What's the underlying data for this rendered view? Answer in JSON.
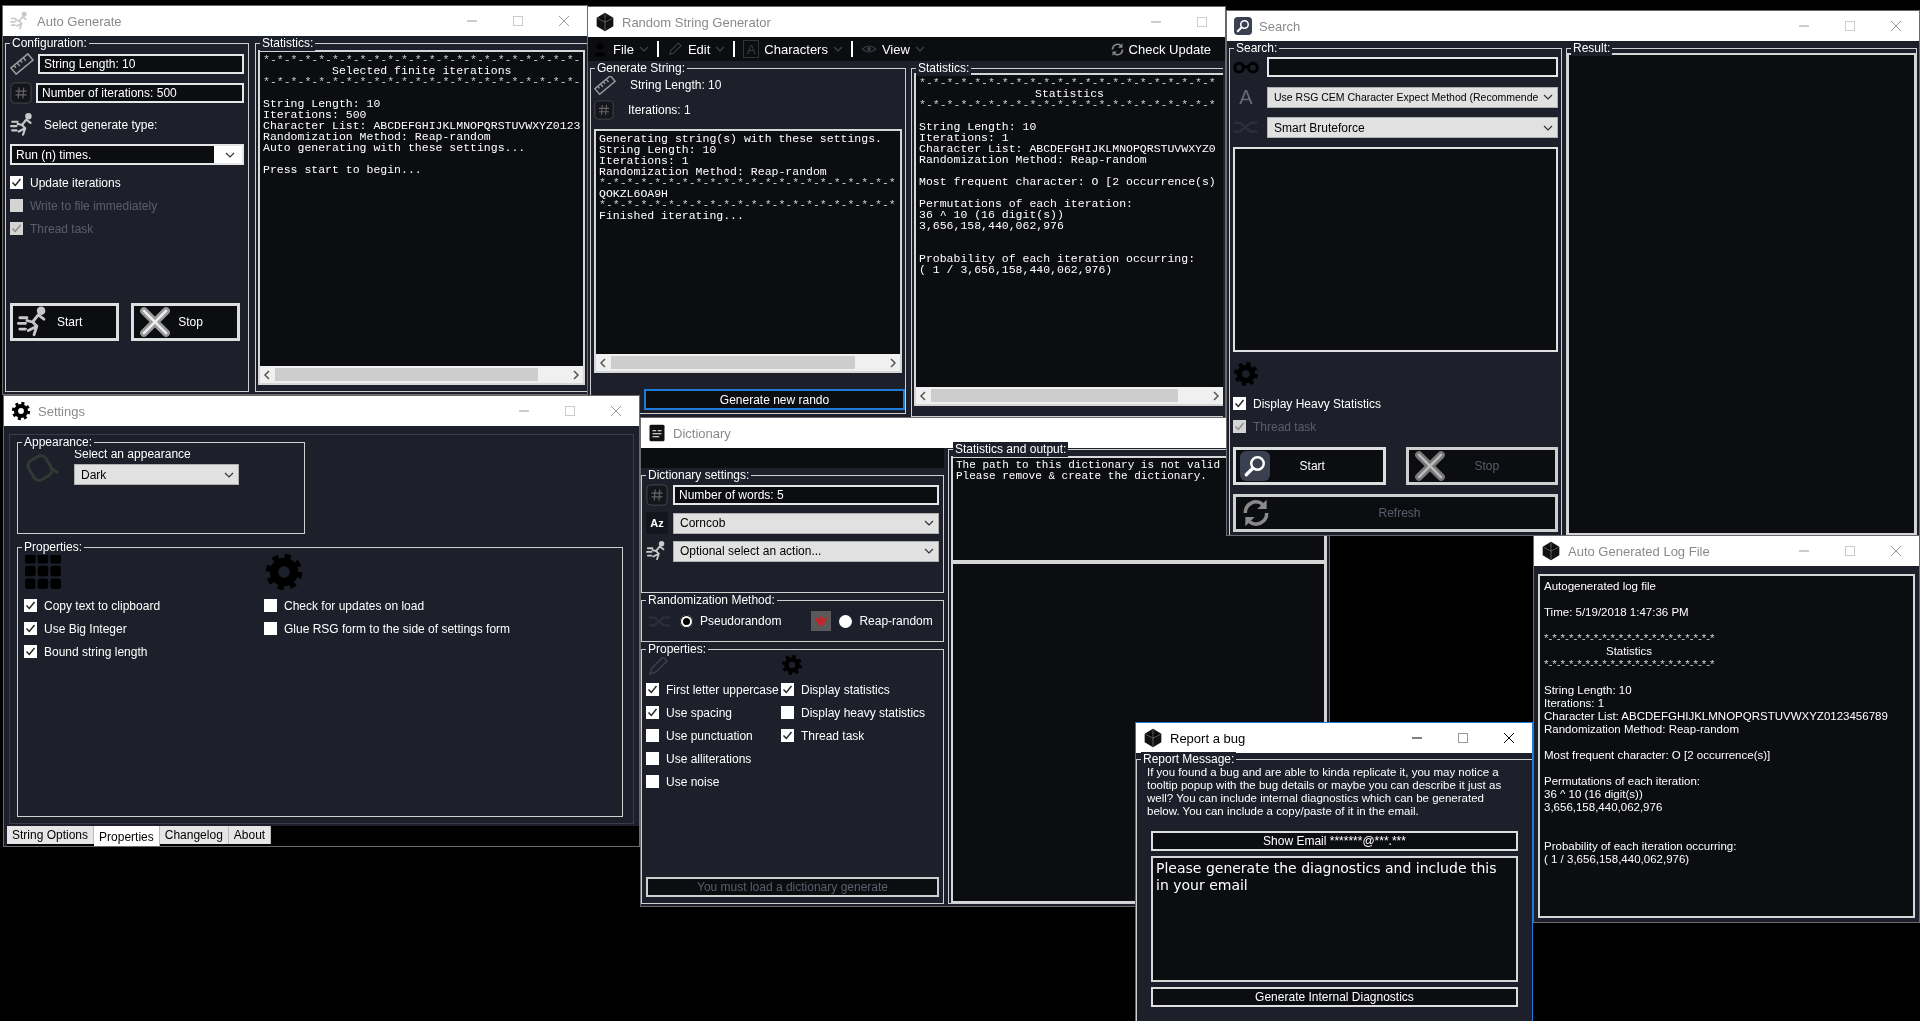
{
  "auto_generate": {
    "title": "Auto Generate",
    "active": false,
    "configuration": {
      "label": "Configuration:",
      "string_length": "String Length: 10",
      "iterations": "Number of iterations: 500",
      "type_label": "Select generate type:",
      "type_value": "Run (n) times.",
      "options": [
        {
          "label": "Update iterations",
          "checked": true,
          "disabled": false
        },
        {
          "label": "Write to file immediately",
          "checked": false,
          "disabled": true
        },
        {
          "label": "Thread task",
          "checked": true,
          "disabled": true
        }
      ],
      "buttons": [
        {
          "kind": "start",
          "label": "Start",
          "disabled": false
        },
        {
          "kind": "stop",
          "label": "Stop",
          "disabled": false
        }
      ]
    },
    "statistics": {
      "label": "Statistics:",
      "lines": [
        {
          "kind": "rule",
          "text": "*-*-*-*-*-*-*-*-*-*-*-*-*-*-*-*-*-*-*-*-*-*-*-"
        },
        {
          "kind": "heading",
          "text": "Selected finite iterations"
        },
        {
          "kind": "rule",
          "text": "*-*-*-*-*-*-*-*-*-*-*-*-*-*-*-*-*-*-*-*-*-*-*-"
        },
        {
          "kind": "gap"
        },
        {
          "kind": "text",
          "text": "String Length: 10"
        },
        {
          "kind": "text",
          "text": "Iterations: 500"
        },
        {
          "kind": "text",
          "text": "Character List: ABCDEFGHIJKLMNOPQRSTUVWXYZ0123"
        },
        {
          "kind": "text",
          "text": "Randomization Method: Reap-random"
        },
        {
          "kind": "text",
          "text": "Auto generating with these settings..."
        },
        {
          "kind": "gap"
        },
        {
          "kind": "text",
          "text": "Press start to begin..."
        }
      ]
    }
  },
  "rsg": {
    "title": "Random String Generator",
    "active": false,
    "menu": [
      {
        "kind": "person",
        "label": "File"
      },
      {
        "kind": "pencil",
        "label": "Edit"
      },
      {
        "kind": "font",
        "icon_text": "A",
        "label": "Characters"
      },
      {
        "kind": "eye",
        "label": "View"
      }
    ],
    "check_update": "Check Update",
    "generate": {
      "label": "Generate String:",
      "string_length": "String Length: 10",
      "iterations": "Iterations: 1",
      "lines": [
        {
          "kind": "text",
          "text": "Generating string(s) with these settings."
        },
        {
          "kind": "text",
          "text": "String Length: 10"
        },
        {
          "kind": "text",
          "text": "Iterations: 1"
        },
        {
          "kind": "text",
          "text": "Randomization Method: Reap-random"
        },
        {
          "kind": "rule",
          "text": "*-*-*-*-*-*-*-*-*-*-*-*-*-*-*-*-*-*-*-*-*-*"
        },
        {
          "kind": "text",
          "text": "QOKZL6OA9H"
        },
        {
          "kind": "rule",
          "text": "*-*-*-*-*-*-*-*-*-*-*-*-*-*-*-*-*-*-*-*-*-*"
        },
        {
          "kind": "text",
          "text": "Finished iterating..."
        }
      ],
      "button": "Generate new rando"
    },
    "statistics": {
      "label": "Statistics:",
      "lines": [
        {
          "kind": "rule",
          "text": "*-*-*-*-*-*-*-*-*-*-*-*-*-*-*-*-*-*-*-*-*-*"
        },
        {
          "kind": "heading",
          "text": "Statistics"
        },
        {
          "kind": "rule",
          "text": "*-*-*-*-*-*-*-*-*-*-*-*-*-*-*-*-*-*-*-*-*-*"
        },
        {
          "kind": "gap"
        },
        {
          "kind": "text",
          "text": "String Length: 10"
        },
        {
          "kind": "text",
          "text": "Iterations: 1"
        },
        {
          "kind": "text",
          "text": "Character List: ABCDEFGHIJKLMNOPQRSTUVWXYZ0"
        },
        {
          "kind": "text",
          "text": "Randomization Method: Reap-random"
        },
        {
          "kind": "gap"
        },
        {
          "kind": "text",
          "text": "Most frequent character: O [2 occurrence(s)"
        },
        {
          "kind": "gap"
        },
        {
          "kind": "text",
          "text": "Permutations of each iteration:"
        },
        {
          "kind": "text",
          "text": "36 ^ 10 (16 digit(s))"
        },
        {
          "kind": "text",
          "text": "3,656,158,440,062,976"
        },
        {
          "kind": "gap"
        },
        {
          "kind": "gap"
        },
        {
          "kind": "text",
          "text": "Probability of each iteration occurring:"
        },
        {
          "kind": "text",
          "text": "( 1 / 3,656,158,440,062,976)"
        }
      ]
    }
  },
  "search": {
    "title": "Search",
    "active": false,
    "search": {
      "label": "Search:",
      "method_icon": "A",
      "method": "Use RSG CEM Character Expect Method (Recommende",
      "algorithm": "Smart Bruteforce",
      "options": [
        {
          "label": "Display Heavy Statistics",
          "checked": true,
          "disabled": false
        },
        {
          "label": "Thread task",
          "checked": true,
          "disabled": true
        }
      ],
      "buttons": [
        {
          "kind": "start",
          "label": "Start",
          "disabled": false
        },
        {
          "kind": "stop",
          "label": "Stop",
          "disabled": true
        },
        {
          "kind": "refresh",
          "label": "Refresh",
          "disabled": true
        }
      ]
    },
    "result": {
      "label": "Result:"
    }
  },
  "settings": {
    "title": "Settings",
    "active": false,
    "appearance": {
      "label": "Appearance:",
      "prompt": "Select an appearance",
      "value": "Dark"
    },
    "properties": {
      "label": "Properties:",
      "left": [
        {
          "label": "Copy text to clipboard",
          "checked": true,
          "disabled": false
        },
        {
          "label": "Use Big Integer",
          "checked": true,
          "disabled": false
        },
        {
          "label": "Bound string length",
          "checked": true,
          "disabled": false
        }
      ],
      "right": [
        {
          "label": "Check for updates on load",
          "checked": false,
          "disabled": false
        },
        {
          "label": "Glue RSG form to the side of settings form",
          "checked": false,
          "disabled": false
        }
      ]
    },
    "tabs": [
      {
        "label": "String Options",
        "selected": false
      },
      {
        "label": "Properties",
        "selected": true
      },
      {
        "label": "Changelog",
        "selected": false
      },
      {
        "label": "About",
        "selected": false
      }
    ]
  },
  "dictionary": {
    "title": "Dictionary",
    "active": false,
    "settings": {
      "label": "Dictionary settings:",
      "words": "Number of words: 5",
      "dictionary_icon": "Az",
      "dictionary": "Corncob",
      "action": "Optional select an action..."
    },
    "randomization": {
      "label": "Randomization Method:",
      "options": [
        {
          "label": "Pseudorandom",
          "selected": true
        },
        {
          "label": "Reap-random",
          "selected": false
        }
      ]
    },
    "properties": {
      "label": "Properties:",
      "left": [
        {
          "label": "First letter uppercase",
          "checked": true,
          "disabled": false
        },
        {
          "label": "Use spacing",
          "checked": true,
          "disabled": false
        },
        {
          "label": "Use punctuation",
          "checked": false,
          "disabled": false
        },
        {
          "label": "Use alliterations",
          "checked": false,
          "disabled": false
        },
        {
          "label": "Use noise",
          "checked": false,
          "disabled": false
        }
      ],
      "right": [
        {
          "label": "Display statistics",
          "checked": true,
          "disabled": false
        },
        {
          "label": "Display heavy statistics",
          "checked": false,
          "disabled": false
        },
        {
          "label": "Thread task",
          "checked": true,
          "disabled": false
        }
      ]
    },
    "button": {
      "label": "You must load a dictionary generate",
      "disabled": true
    },
    "output": {
      "label": "Statistics and output:",
      "lines": [
        {
          "kind": "text",
          "text": "The path to this dictionary is not valid"
        },
        {
          "kind": "text",
          "text": "Please remove & create the dictionary."
        }
      ]
    }
  },
  "report_bug": {
    "title": "Report a bug",
    "active": true,
    "label": "Report Message:",
    "message": "If you found a bug and are able to kinda replicate it, you may notice a tooltip popup with the bug details or maybe you can describe it just as well? You can include internal diagnostics which can be generated below. You can include a copy/paste of it in the email.",
    "show_email": "Show Email *******@***.***",
    "body": "Please generate the diagnostics and include this in your email",
    "generate": "Generate Internal Diagnostics"
  },
  "log_file": {
    "title": "Auto Generated Log File",
    "active": false,
    "lines": [
      {
        "kind": "text",
        "text": "Autogenerated log file"
      },
      {
        "kind": "gap"
      },
      {
        "kind": "text",
        "text": "Time: 5/19/2018 1:47:36 PM"
      },
      {
        "kind": "gap"
      },
      {
        "kind": "rule",
        "text": "*-*-*-*-*-*-*-*-*-*-*-*-*-*-*-*-*-*-*-*-*"
      },
      {
        "kind": "heading",
        "text": "Statistics"
      },
      {
        "kind": "rule",
        "text": "*-*-*-*-*-*-*-*-*-*-*-*-*-*-*-*-*-*-*-*-*"
      },
      {
        "kind": "gap"
      },
      {
        "kind": "text",
        "text": "String Length: 10"
      },
      {
        "kind": "text",
        "text": "Iterations: 1"
      },
      {
        "kind": "text",
        "text": "Character List: ABCDEFGHIJKLMNOPQRSTUVWXYZ0123456789"
      },
      {
        "kind": "text",
        "text": "Randomization Method: Reap-random"
      },
      {
        "kind": "gap"
      },
      {
        "kind": "text",
        "text": "Most frequent character: O [2 occurrence(s)]"
      },
      {
        "kind": "gap"
      },
      {
        "kind": "text",
        "text": "Permutations of each iteration:"
      },
      {
        "kind": "text",
        "text": "36 ^ 10 (16 digit(s))"
      },
      {
        "kind": "text",
        "text": "3,656,158,440,062,976"
      },
      {
        "kind": "gap"
      },
      {
        "kind": "gap"
      },
      {
        "kind": "text",
        "text": "Probability of each iteration occurring:"
      },
      {
        "kind": "text",
        "text": "( 1 / 3,656,158,440,062,976)"
      }
    ]
  }
}
